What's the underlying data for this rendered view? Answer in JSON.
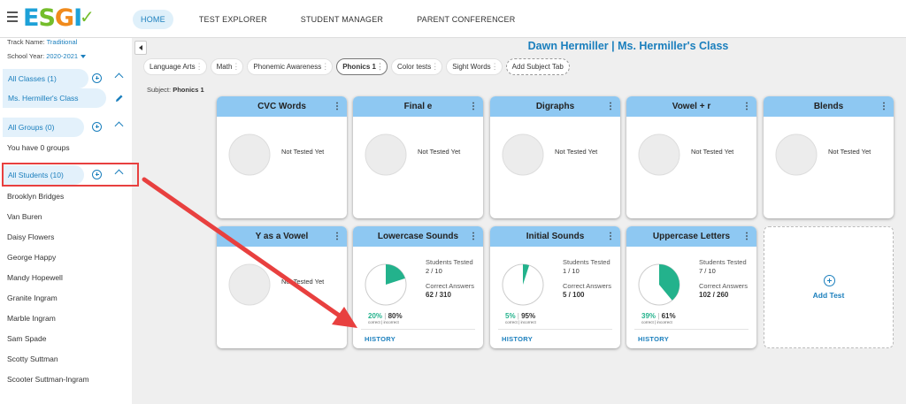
{
  "header": {
    "logo_text": "ESGI",
    "nav": [
      {
        "label": "HOME",
        "active": true
      },
      {
        "label": "TEST EXPLORER",
        "active": false
      },
      {
        "label": "STUDENT MANAGER",
        "active": false
      },
      {
        "label": "PARENT CONFERENCER",
        "active": false
      }
    ]
  },
  "sidebar": {
    "track_label": "Track Name:",
    "track_value": "Traditional",
    "year_label": "School Year:",
    "year_value": "2020-2021",
    "classes_label": "All Classes (1)",
    "class_name": "Ms. Hermiller's Class",
    "groups_label": "All Groups (0)",
    "groups_empty": "You have 0 groups",
    "students_label": "All Students (10)",
    "students": [
      "Brooklyn Bridges",
      "Van Buren",
      "Daisy Flowers",
      "George Happy",
      "Mandy Hopewell",
      "Granite Ingram",
      "Marble Ingram",
      "Sam Spade",
      "Scotty Suttman",
      "Scooter Suttman-Ingram"
    ]
  },
  "main": {
    "title": "Dawn Hermiller | Ms. Hermiller's Class",
    "subject_tabs": [
      {
        "label": "Language Arts",
        "active": false
      },
      {
        "label": "Math",
        "active": false
      },
      {
        "label": "Phonemic Awareness",
        "active": false
      },
      {
        "label": "Phonics 1",
        "active": true
      },
      {
        "label": "Color tests",
        "active": false
      },
      {
        "label": "Sight Words",
        "active": false
      }
    ],
    "add_subject_label": "Add Subject Tab",
    "subject_prefix": "Subject:",
    "subject_value": "Phonics 1",
    "not_tested_label": "Not Tested Yet",
    "students_tested_label": "Students Tested",
    "correct_answers_label": "Correct Answers",
    "history_label": "HISTORY",
    "correct_small": "correct",
    "incorrect_small": "incorrect",
    "add_test_label": "Add Test",
    "tests": [
      {
        "name": "CVC Words",
        "tested": false
      },
      {
        "name": "Final e",
        "tested": false
      },
      {
        "name": "Digraphs",
        "tested": false
      },
      {
        "name": "Vowel + r",
        "tested": false
      },
      {
        "name": "Blends",
        "tested": false
      },
      {
        "name": "Y as a Vowel",
        "tested": false
      },
      {
        "name": "Lowercase Sounds",
        "tested": true,
        "students_tested": "2 / 10",
        "correct_answers": "62 / 310",
        "correct_pct": "20%",
        "incorrect_pct": "80%",
        "fraction": 0.2
      },
      {
        "name": "Initial Sounds",
        "tested": true,
        "students_tested": "1 / 10",
        "correct_answers": "5 / 100",
        "correct_pct": "5%",
        "incorrect_pct": "95%",
        "fraction": 0.05
      },
      {
        "name": "Uppercase Letters",
        "tested": true,
        "students_tested": "7 / 10",
        "correct_answers": "102 / 260",
        "correct_pct": "39%",
        "incorrect_pct": "61%",
        "fraction": 0.39
      }
    ]
  },
  "colors": {
    "accent": "#1b7fbd",
    "card_header": "#8ec8f2",
    "correct": "#23b28c",
    "annotation": "#e8403f"
  }
}
